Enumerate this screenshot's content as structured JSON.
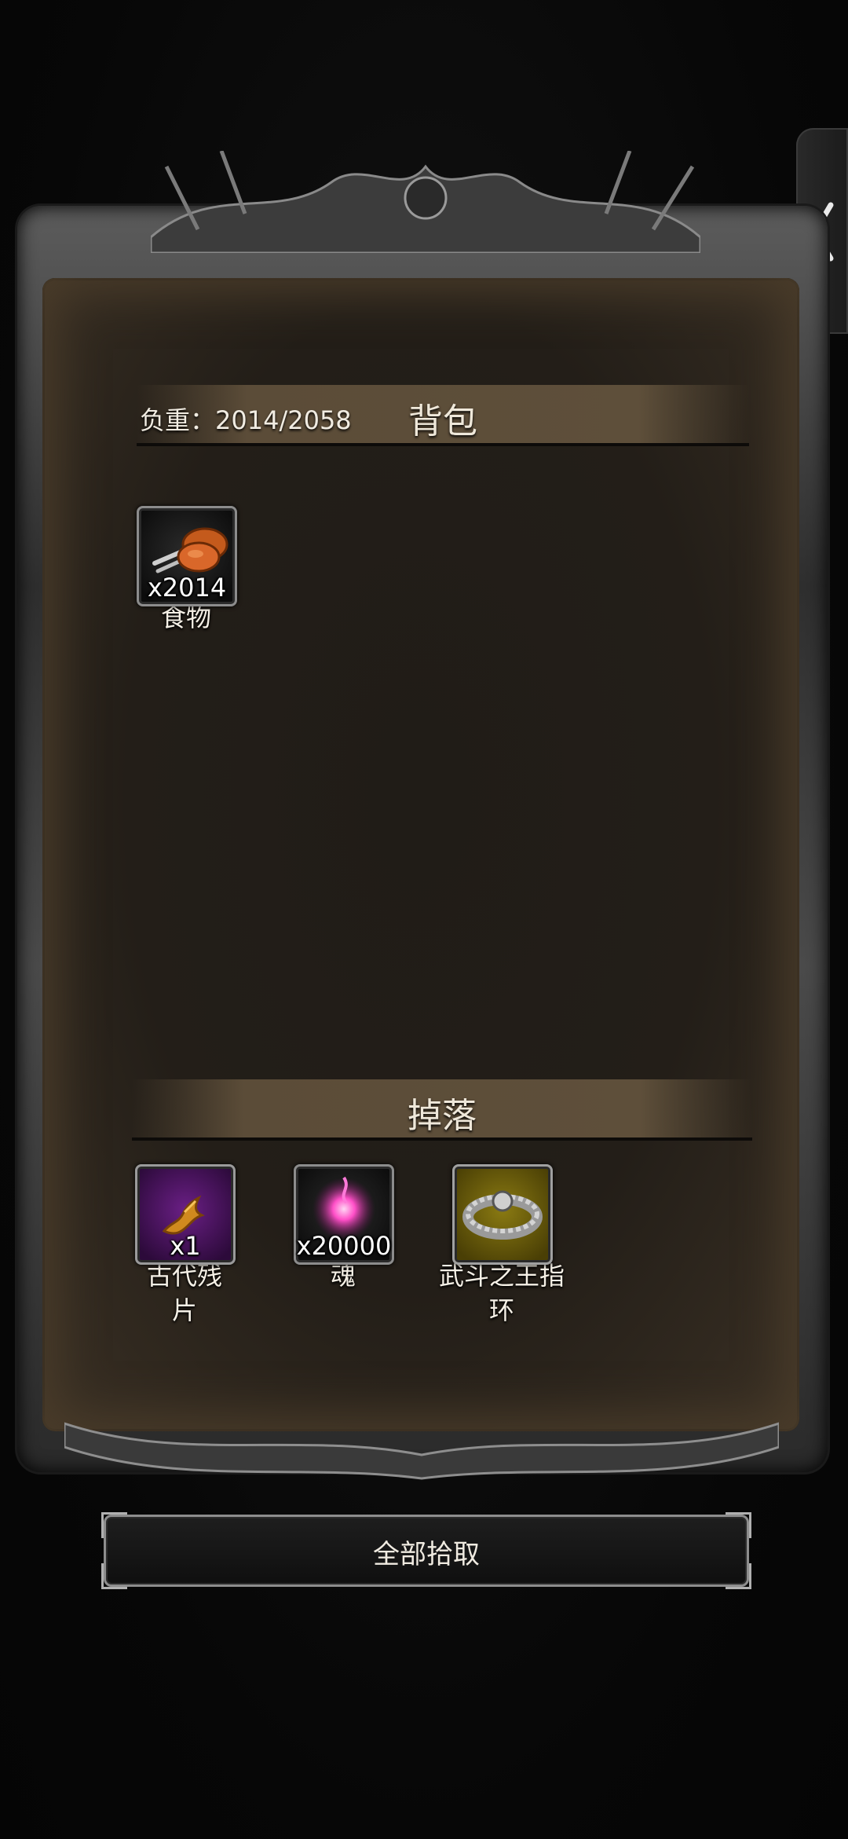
{
  "side_tab": {
    "icon": "chevron-left-icon"
  },
  "backpack": {
    "title": "背包",
    "weight_label": "负重：2014/2058",
    "items": [
      {
        "name": "食物",
        "qty": "x2014",
        "icon": "meat-icon",
        "rarity": "common"
      }
    ]
  },
  "drops": {
    "title": "掉落",
    "items": [
      {
        "name": "古代残片",
        "qty": "x1",
        "icon": "ancient-shard-icon",
        "rarity": "purple"
      },
      {
        "name": "魂",
        "qty": "x20000",
        "icon": "soul-orb-icon",
        "rarity": "common"
      },
      {
        "name": "武斗之王指环",
        "qty": "",
        "icon": "ring-icon",
        "rarity": "gold"
      }
    ]
  },
  "actions": {
    "pickup_all_label": "全部拾取"
  },
  "colors": {
    "panel": "#231e18",
    "header": "#5e4f3a",
    "purple_slot": "#6a1f85",
    "gold_slot": "#8a7a12"
  }
}
